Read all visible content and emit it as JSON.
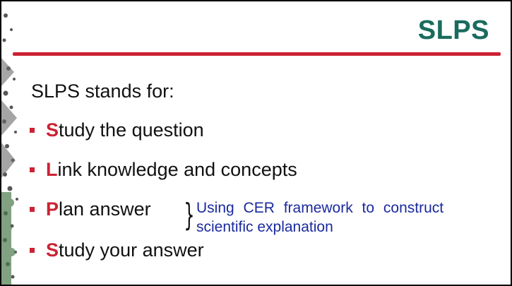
{
  "slide": {
    "title": "SLPS",
    "intro": "SLPS stands for:",
    "bullets": [
      {
        "first": "S",
        "rest": "tudy the question"
      },
      {
        "first": "L",
        "rest": "ink knowledge and concepts"
      },
      {
        "first": "P",
        "rest": "lan answer"
      },
      {
        "first": "S",
        "rest": "tudy your answer"
      }
    ],
    "note": {
      "line1": "Using CER framework to construct",
      "line2": "scientific explanation"
    }
  },
  "colors": {
    "title": "#1a6b5e",
    "accent": "#cc2233",
    "note": "#1a2a9e"
  }
}
